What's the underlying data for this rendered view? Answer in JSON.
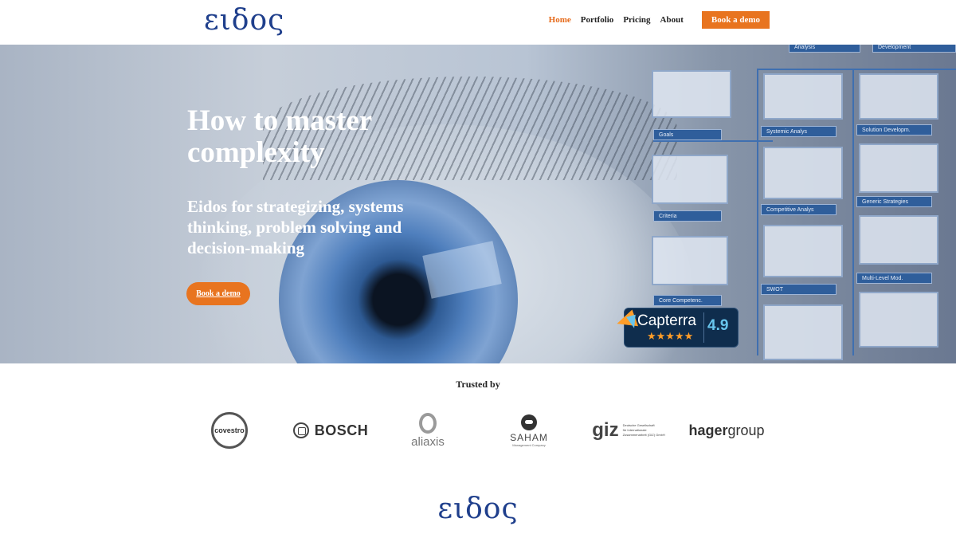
{
  "header": {
    "logo": "ειδος",
    "nav": [
      {
        "label": "Home",
        "active": true
      },
      {
        "label": "Portfolio",
        "active": false
      },
      {
        "label": "Pricing",
        "active": false
      },
      {
        "label": "About",
        "active": false
      }
    ],
    "cta": "Book a demo"
  },
  "hero": {
    "title": "How to master complexity",
    "subtitle": "Eidos for strategizing, systems thinking, problem solving and decision-making",
    "cta": "Book a demo",
    "panels": [
      "Goals",
      "Criteria",
      "Core Competenc.",
      "Systemic Analys",
      "Competitive Analys",
      "SWOT",
      "Solution Developm.",
      "Generic Strategies",
      "Multi-Level Mod.",
      "Analysis",
      "Development"
    ],
    "capterra": {
      "name": "Capterra",
      "score": "4.9",
      "stars": "★★★★★"
    }
  },
  "trusted": {
    "heading": "Trusted by",
    "clients": {
      "covestro": "covestro",
      "bosch": "BOSCH",
      "aliaxis": "aliaxis",
      "saham": "SAHAM",
      "saham_sub": "Management Company",
      "giz": "giz",
      "giz_sub1": "Deutsche Gesellschaft",
      "giz_sub2": "für Internationale",
      "giz_sub3": "Zusammenarbeit (GIZ) GmbH",
      "hager_a": "hager",
      "hager_b": "group"
    }
  },
  "footer": {
    "logo": "ειδος"
  },
  "colors": {
    "accent": "#e8741f",
    "brand": "#1f3f8c",
    "capterra_bg": "#0f2d4d",
    "capterra_blue": "#68c5ed",
    "capterra_orange": "#ff9d28"
  }
}
